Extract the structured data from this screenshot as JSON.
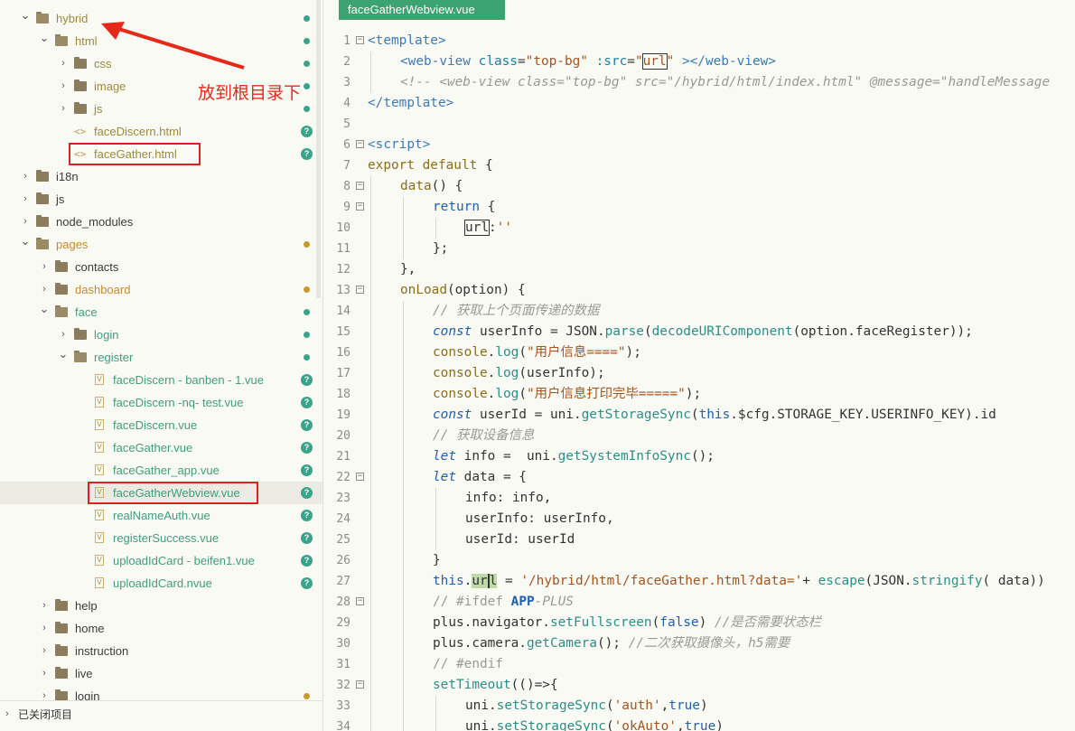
{
  "sidebar": {
    "items": [
      {
        "label": "hybrid",
        "depth": 0,
        "kind": "folder",
        "open": true,
        "color": "olive",
        "mark": "dot"
      },
      {
        "label": "html",
        "depth": 1,
        "kind": "folder",
        "open": true,
        "color": "olive",
        "mark": "dot"
      },
      {
        "label": "css",
        "depth": 2,
        "kind": "folder",
        "open": false,
        "color": "olive",
        "mark": "dot"
      },
      {
        "label": "image",
        "depth": 2,
        "kind": "folder",
        "open": false,
        "color": "olive",
        "mark": "dot"
      },
      {
        "label": "js",
        "depth": 2,
        "kind": "folder",
        "open": false,
        "color": "olive",
        "mark": "dot"
      },
      {
        "label": "faceDiscern.html",
        "depth": 2,
        "kind": "html",
        "color": "olive",
        "mark": "q"
      },
      {
        "label": "faceGather.html",
        "depth": 2,
        "kind": "html",
        "color": "olive",
        "mark": "q",
        "boxed": true
      },
      {
        "label": "i18n",
        "depth": 0,
        "kind": "folder",
        "open": false,
        "color": "plain",
        "mark": ""
      },
      {
        "label": "js",
        "depth": 0,
        "kind": "folder",
        "open": false,
        "color": "plain",
        "mark": ""
      },
      {
        "label": "node_modules",
        "depth": 0,
        "kind": "folder",
        "open": false,
        "color": "plain",
        "mark": ""
      },
      {
        "label": "pages",
        "depth": 0,
        "kind": "folder",
        "open": true,
        "color": "orange",
        "mark": "dot-orange"
      },
      {
        "label": "contacts",
        "depth": 1,
        "kind": "folder",
        "open": false,
        "color": "plain",
        "mark": ""
      },
      {
        "label": "dashboard",
        "depth": 1,
        "kind": "folder",
        "open": false,
        "color": "orange",
        "mark": "dot-orange"
      },
      {
        "label": "face",
        "depth": 1,
        "kind": "folder",
        "open": true,
        "color": "green",
        "mark": "dot"
      },
      {
        "label": "login",
        "depth": 2,
        "kind": "folder",
        "open": false,
        "color": "green",
        "mark": "dot"
      },
      {
        "label": "register",
        "depth": 2,
        "kind": "folder",
        "open": true,
        "color": "green",
        "mark": "dot"
      },
      {
        "label": "faceDiscern - banben - 1.vue",
        "depth": 3,
        "kind": "vue",
        "color": "green",
        "mark": "q"
      },
      {
        "label": "faceDiscern -nq- test.vue",
        "depth": 3,
        "kind": "vue",
        "color": "green",
        "mark": "q"
      },
      {
        "label": "faceDiscern.vue",
        "depth": 3,
        "kind": "vue",
        "color": "green",
        "mark": "q"
      },
      {
        "label": "faceGather.vue",
        "depth": 3,
        "kind": "vue",
        "color": "green",
        "mark": "q"
      },
      {
        "label": "faceGather_app.vue",
        "depth": 3,
        "kind": "vue",
        "color": "green",
        "mark": "q"
      },
      {
        "label": "faceGatherWebview.vue",
        "depth": 3,
        "kind": "vue",
        "color": "green",
        "mark": "q",
        "boxed": true,
        "selected": true
      },
      {
        "label": "realNameAuth.vue",
        "depth": 3,
        "kind": "vue",
        "color": "green",
        "mark": "q"
      },
      {
        "label": "registerSuccess.vue",
        "depth": 3,
        "kind": "vue",
        "color": "green",
        "mark": "q"
      },
      {
        "label": "uploadIdCard - beifen1.vue",
        "depth": 3,
        "kind": "vue",
        "color": "green",
        "mark": "q"
      },
      {
        "label": "uploadIdCard.nvue",
        "depth": 3,
        "kind": "vue",
        "color": "green",
        "mark": "q"
      },
      {
        "label": "help",
        "depth": 1,
        "kind": "folder",
        "open": false,
        "color": "plain",
        "mark": ""
      },
      {
        "label": "home",
        "depth": 1,
        "kind": "folder",
        "open": false,
        "color": "plain",
        "mark": ""
      },
      {
        "label": "instruction",
        "depth": 1,
        "kind": "folder",
        "open": false,
        "color": "plain",
        "mark": ""
      },
      {
        "label": "live",
        "depth": 1,
        "kind": "folder",
        "open": false,
        "color": "plain",
        "mark": ""
      },
      {
        "label": "login",
        "depth": 1,
        "kind": "folder",
        "open": false,
        "color": "plain",
        "mark": "dot-orange"
      }
    ],
    "annotation": "放到根目录下",
    "closed_projects": "已关闭项目"
  },
  "editor": {
    "tab_title": "faceGatherWebview.vue",
    "lines": [
      {
        "n": "1",
        "fold": "⊟",
        "indent": 0,
        "html": "<span class='tg'>&lt;template&gt;</span>"
      },
      {
        "n": "2",
        "fold": "",
        "indent": 1,
        "html": "<span class='tg'>&lt;web-view</span> <span class='at'>class</span>=<span class='st'>\"top-bg\"</span> <span class='at'>:src</span>=<span class='st'>\"<span class='bx'>url</span>\"</span> <span class='tg'>&gt;&lt;/web-view&gt;</span>"
      },
      {
        "n": "3",
        "fold": "",
        "indent": 1,
        "html": "<span class='cm'>&lt;!-- &lt;web-view class=\"top-bg\" src=\"/hybrid/html/index.html\" @message=\"handleMessage</span>"
      },
      {
        "n": "4",
        "fold": "",
        "indent": 0,
        "html": "<span class='tg'>&lt;/template&gt;</span>"
      },
      {
        "n": "5",
        "fold": "",
        "indent": 0,
        "html": ""
      },
      {
        "n": "6",
        "fold": "⊟",
        "indent": 0,
        "html": "<span class='tg'>&lt;script&gt;</span>"
      },
      {
        "n": "7",
        "fold": "",
        "indent": 0,
        "html": "<span class='mt'>export default</span> {"
      },
      {
        "n": "8",
        "fold": "⊟",
        "indent": 1,
        "html": "<span class='mt'>data</span>() {"
      },
      {
        "n": "9",
        "fold": "⊟",
        "indent": 2,
        "html": "<span class='kw'>return</span> {"
      },
      {
        "n": "10",
        "fold": "",
        "indent": 3,
        "html": "<span class='bx'>url</span>:<span class='st'>''</span>"
      },
      {
        "n": "11",
        "fold": "",
        "indent": 2,
        "html": "};"
      },
      {
        "n": "12",
        "fold": "",
        "indent": 1,
        "html": "},"
      },
      {
        "n": "13",
        "fold": "⊟",
        "indent": 1,
        "html": "<span class='mt'>onLoad</span>(option) {"
      },
      {
        "n": "14",
        "fold": "",
        "indent": 2,
        "html": "<span class='cm'>// 获取上个页面传递的数据</span>"
      },
      {
        "n": "15",
        "fold": "",
        "indent": 2,
        "html": "<span class='kwi'>const</span> userInfo = JSON.<span class='fn'>parse</span>(<span class='fn'>decodeURIComponent</span>(option.faceRegister));"
      },
      {
        "n": "16",
        "fold": "",
        "indent": 2,
        "html": "<span class='mt'>console</span>.<span class='fn'>log</span>(<span class='st'>\"用户信息====\"</span>);"
      },
      {
        "n": "17",
        "fold": "",
        "indent": 2,
        "html": "<span class='mt'>console</span>.<span class='fn'>log</span>(userInfo);"
      },
      {
        "n": "18",
        "fold": "",
        "indent": 2,
        "html": "<span class='mt'>console</span>.<span class='fn'>log</span>(<span class='st'>\"用户信息打印完毕=====\"</span>);"
      },
      {
        "n": "19",
        "fold": "",
        "indent": 2,
        "html": "<span class='kwi'>const</span> userId = uni.<span class='fn'>getStorageSync</span>(<span class='kw'>this</span>.$cfg.STORAGE_KEY.USERINFO_KEY).id"
      },
      {
        "n": "20",
        "fold": "",
        "indent": 2,
        "html": "<span class='cm'>// 获取设备信息</span>"
      },
      {
        "n": "21",
        "fold": "",
        "indent": 2,
        "html": "<span class='kwi'>let</span> info =  uni.<span class='fn'>getSystemInfoSync</span>();"
      },
      {
        "n": "22",
        "fold": "⊟",
        "indent": 2,
        "html": "<span class='kwi'>let</span> data = {"
      },
      {
        "n": "23",
        "fold": "",
        "indent": 3,
        "html": "info: info,"
      },
      {
        "n": "24",
        "fold": "",
        "indent": 3,
        "html": "userInfo: userInfo,"
      },
      {
        "n": "25",
        "fold": "",
        "indent": 3,
        "html": "userId: userId"
      },
      {
        "n": "26",
        "fold": "",
        "indent": 2,
        "html": "}"
      },
      {
        "n": "27",
        "fold": "",
        "indent": 2,
        "html": "<span class='kw'>this</span>.<span class='hl'>ur<span class='caret'></span>l</span> = <span class='st'>'/hybrid/html/faceGather.html?data='</span>+ <span class='fn'>escape</span>(JSON.<span class='fn'>stringify</span>( data))"
      },
      {
        "n": "28",
        "fold": "⊟",
        "indent": 2,
        "html": "<span class='cm' style='font-style:normal'>// #ifdef</span> <span class='pp'>APP</span><span class='cm'>-PLUS</span>"
      },
      {
        "n": "29",
        "fold": "",
        "indent": 2,
        "html": "plus.navigator.<span class='fn'>setFullscreen</span>(<span class='kw'>false</span>) <span class='cm'>//是否需要状态栏</span>"
      },
      {
        "n": "30",
        "fold": "",
        "indent": 2,
        "html": "plus.camera.<span class='fn'>getCamera</span>(); <span class='cm'>//二次获取摄像头，h5需要</span>"
      },
      {
        "n": "31",
        "fold": "",
        "indent": 2,
        "html": "<span class='cm' style='font-style:normal'>// #endif</span>"
      },
      {
        "n": "32",
        "fold": "⊟",
        "indent": 2,
        "html": "<span class='fn'>setTimeout</span>(()=>{"
      },
      {
        "n": "33",
        "fold": "",
        "indent": 3,
        "html": "uni.<span class='fn'>setStorageSync</span>(<span class='st'>'auth'</span>,<span class='kw'>true</span>)"
      },
      {
        "n": "34",
        "fold": "",
        "indent": 3,
        "html": "uni.<span class='fn'>setStorageSync</span>(<span class='st'>'okAuto'</span>,<span class='kw'>true</span>)"
      }
    ]
  }
}
